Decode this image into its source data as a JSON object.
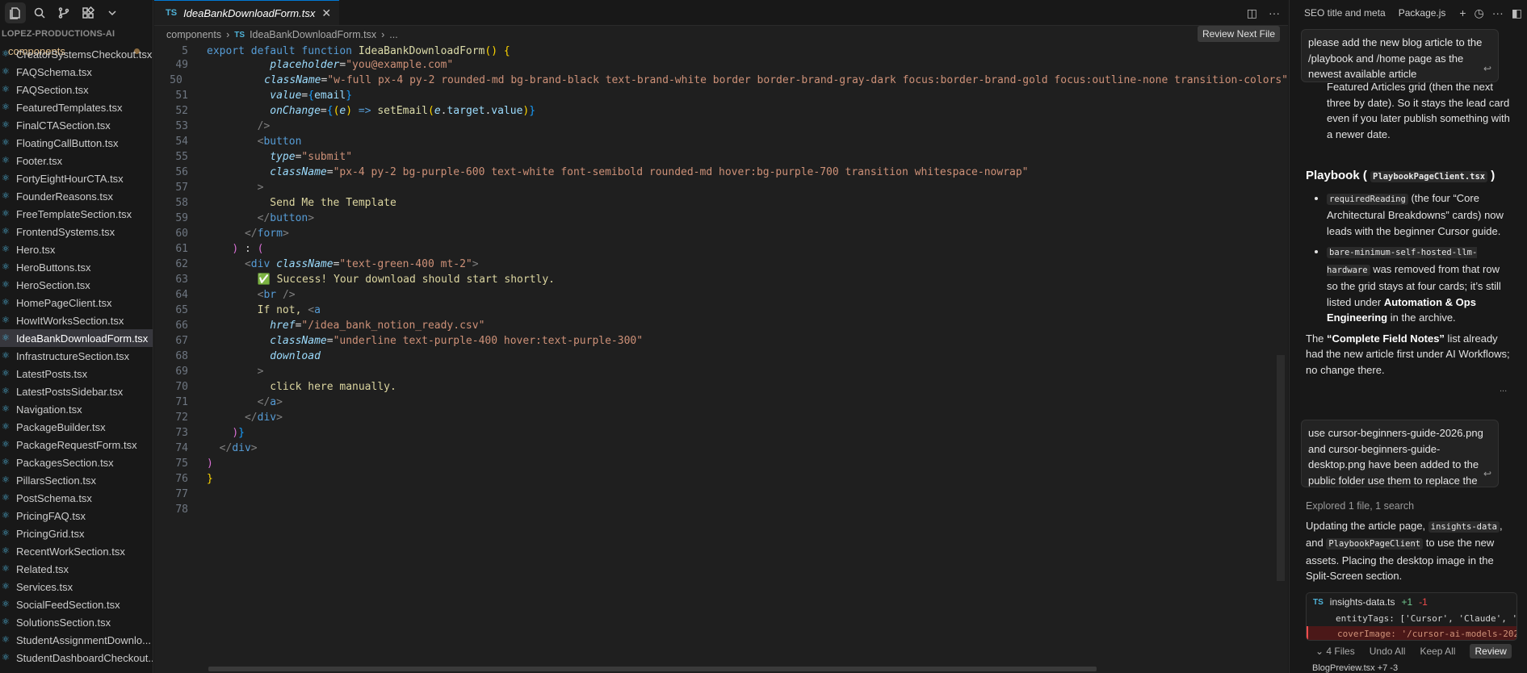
{
  "sidebar": {
    "project": "LOPEZ-PRODUCTIONS-AI",
    "folder": "components",
    "files": [
      "CreatorSystemsCheckout.tsx",
      "FAQSchema.tsx",
      "FAQSection.tsx",
      "FeaturedTemplates.tsx",
      "FinalCTASection.tsx",
      "FloatingCallButton.tsx",
      "Footer.tsx",
      "FortyEightHourCTA.tsx",
      "FounderReasons.tsx",
      "FreeTemplateSection.tsx",
      "FrontendSystems.tsx",
      "Hero.tsx",
      "HeroButtons.tsx",
      "HeroSection.tsx",
      "HomePageClient.tsx",
      "HowItWorksSection.tsx",
      "IdeaBankDownloadForm.tsx",
      "InfrastructureSection.tsx",
      "LatestPosts.tsx",
      "LatestPostsSidebar.tsx",
      "Navigation.tsx",
      "PackageBuilder.tsx",
      "PackageRequestForm.tsx",
      "PackagesSection.tsx",
      "PillarsSection.tsx",
      "PostSchema.tsx",
      "PricingFAQ.tsx",
      "PricingGrid.tsx",
      "RecentWorkSection.tsx",
      "Related.tsx",
      "Services.tsx",
      "SocialFeedSection.tsx",
      "SolutionsSection.tsx",
      "StudentAssignmentDownlo...",
      "StudentDashboardCheckout..."
    ],
    "selected_index": 16
  },
  "editor": {
    "tab_label": "IdeaBankDownloadForm.tsx",
    "tab_lang": "TS",
    "breadcrumb": [
      "components",
      "IdeaBankDownloadForm.tsx",
      "..."
    ],
    "review_next": "Review Next File",
    "header_line_number": "5",
    "header_line": "export default function IdeaBankDownloadForm() {"
  },
  "panel": {
    "tab1": "SEO title and meta",
    "tab2": "Package.js",
    "msg1": "please add the new blog article to the /playbook and /home page as the newest available article",
    "partial_text": "Featured Articles grid (then the next three by date). So it stays the lead card even if you later publish something with a newer date.",
    "playbook_heading": "Playbook (",
    "playbook_code": "PlaybookPageClient.tsx",
    "playbook_close": ")",
    "bullet1_code": "requiredReading",
    "bullet1_text": " (the four “Core Architectural Breakdowns” cards) now leads with the beginner Cursor guide.",
    "bullet2_code": "bare-minimum-self-hosted-llm-hardware",
    "bullet2_text_a": " was removed from that row so the grid stays at four cards; it’s still listed under ",
    "bullet2_bold": "Automation & Ops Engineering",
    "bullet2_text_b": " in the archive.",
    "para_a": "The ",
    "para_bold": "“Complete Field Notes”",
    "para_b": " list already had the new article first under AI Workflows; no change there.",
    "ellipsis": "...",
    "msg2": "use cursor-beginners-guide-2026.png and cursor-beginners-guide-desktop.png have been added to the public folder use them to replace the",
    "explored_label": "Explored",
    "explored_detail": "1 file, 1 search",
    "update_a": "Updating the article page, ",
    "update_code1": "insights-data",
    "update_b": ", and ",
    "update_code2": "PlaybookPageClient",
    "update_c": " to use the new assets. Placing the desktop image in the Split-Screen section.",
    "diff_lang": "TS",
    "diff_file": "insights-data.ts",
    "diff_plus": "+1",
    "diff_minus": "-1",
    "diff_line1": "entityTags: ['Cursor', 'Claude', '",
    "diff_line2": "coverImage: '/cursor-ai-models-202",
    "files_label": "4 Files",
    "undo_all": "Undo All",
    "keep_all": "Keep All",
    "review": "Review",
    "bottom_file": "BlogPreview.tsx +7 -3"
  }
}
